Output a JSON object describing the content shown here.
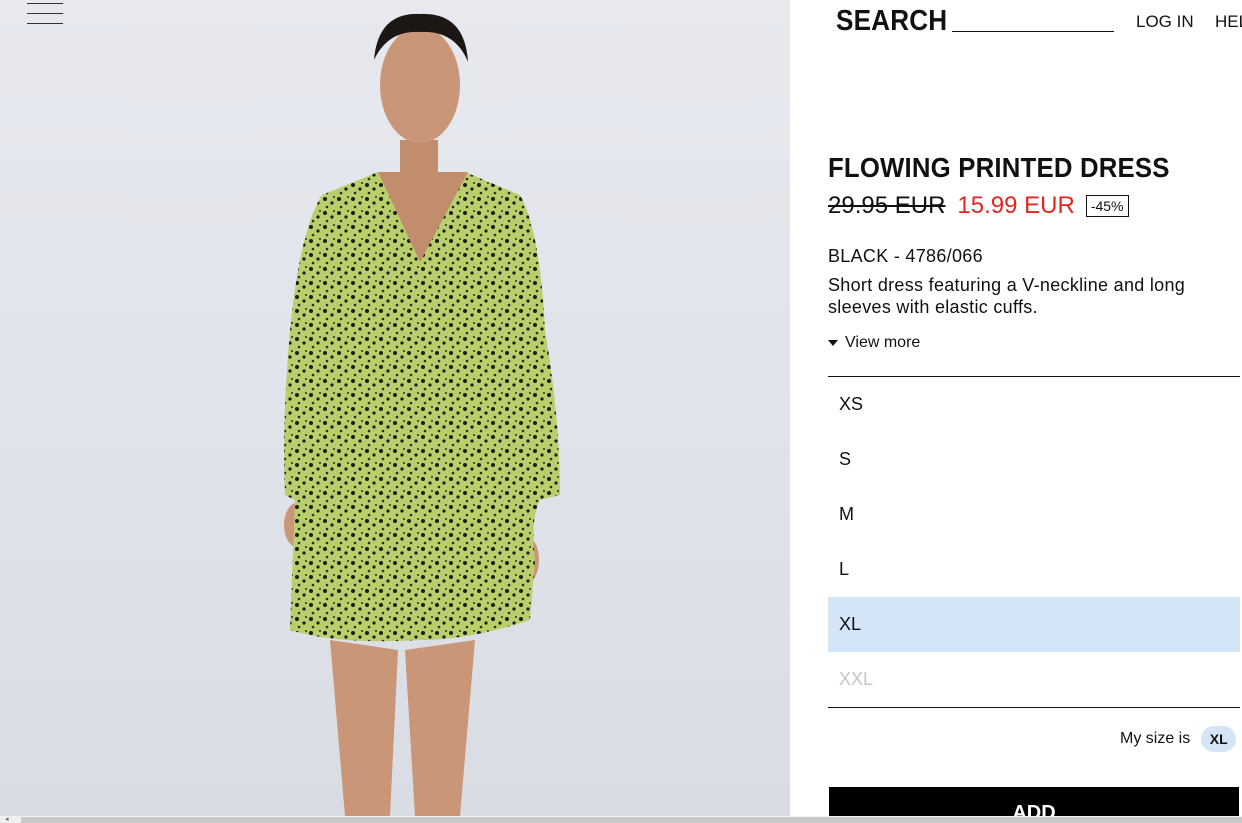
{
  "header": {
    "search_label": "SEARCH",
    "login_label": "LOG IN",
    "help_label": "HEL"
  },
  "product": {
    "title": "FLOWING PRINTED DRESS",
    "old_price": "29.95 EUR",
    "new_price": "15.99 EUR",
    "discount": "-45%",
    "color_ref": "BLACK - 4786/066",
    "description": "Short dress featuring a V-neckline and long sleeves with elastic cuffs.",
    "view_more": "View more"
  },
  "sizes": [
    {
      "label": "XS",
      "state": "available"
    },
    {
      "label": "S",
      "state": "available"
    },
    {
      "label": "M",
      "state": "available"
    },
    {
      "label": "L",
      "state": "available"
    },
    {
      "label": "XL",
      "state": "selected"
    },
    {
      "label": "XXL",
      "state": "unavailable"
    }
  ],
  "my_size": {
    "label": "My size is",
    "value": "XL"
  },
  "add_button": "ADD",
  "colors": {
    "sale_red": "#e52521",
    "selected_bg": "#d4e5f8",
    "dress_green": "#b8cf6a"
  }
}
